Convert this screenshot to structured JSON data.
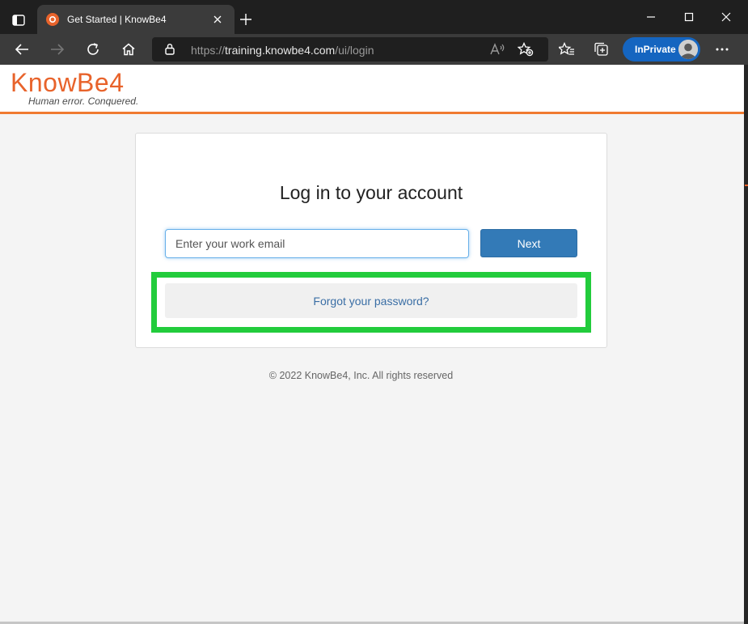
{
  "browser": {
    "tab": {
      "title": "Get Started | KnowBe4"
    },
    "address": {
      "scheme": "https://",
      "host": "training.knowbe4.com",
      "path": "/ui/login"
    },
    "inprivate_label": "InPrivate",
    "colors": {
      "tab_bg": "#3b3b3b",
      "frame_bg": "#1f1f1f",
      "inprivate": "#1565c0"
    }
  },
  "header": {
    "logo_word": "KnowBe4",
    "logo_tagline": "Human error. Conquered.",
    "accent_color": "#f07a30"
  },
  "login": {
    "title": "Log in to your account",
    "email_placeholder": "Enter your work email",
    "email_value": "",
    "next_label": "Next",
    "forgot_label": "Forgot your password?",
    "highlight_color": "#22cc3c"
  },
  "footer": {
    "copyright": "© 2022 KnowBe4, Inc. All rights reserved"
  }
}
